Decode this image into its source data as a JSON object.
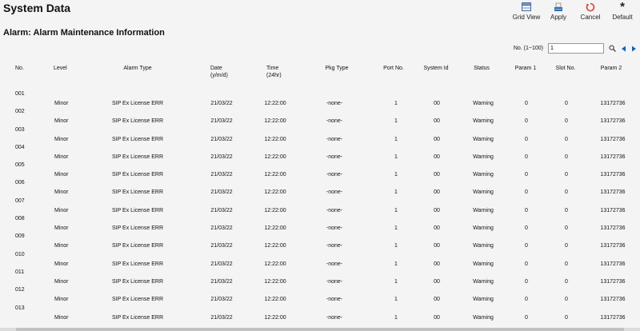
{
  "header": {
    "title": "System Data"
  },
  "toolbar": {
    "grid_view": "Grid View",
    "apply": "Apply",
    "cancel": "Cancel",
    "default": "Default"
  },
  "section": {
    "title": "Alarm: Alarm Maintenance Information"
  },
  "pager": {
    "label": "No. (1~100)",
    "value": "1"
  },
  "table": {
    "headers": {
      "no": "No.",
      "level": "Level",
      "alarm_type": "Alarm Type",
      "date": "Date",
      "date_sub": "(y/m/d)",
      "time": "Time",
      "time_sub": "(24hr)",
      "pkg_type": "Pkg Type",
      "port_no": "Port No.",
      "system_id": "System Id",
      "status": "Status",
      "param1": "Param 1",
      "slot_no": "Slot No.",
      "param2": "Param 2"
    },
    "rows": [
      {
        "no": "001",
        "level": "Minor",
        "alarm_type": "SIP Ex License ERR",
        "date": "21/03/22",
        "time": "12:22:00",
        "pkg_type": "-none-",
        "port_no": "1",
        "system_id": "00",
        "status": "Warning",
        "param1": "0",
        "slot_no": "0",
        "param2": "13172736"
      },
      {
        "no": "002",
        "level": "Minor",
        "alarm_type": "SIP Ex License ERR",
        "date": "21/03/22",
        "time": "12:22:00",
        "pkg_type": "-none-",
        "port_no": "1",
        "system_id": "00",
        "status": "Warning",
        "param1": "0",
        "slot_no": "0",
        "param2": "13172736"
      },
      {
        "no": "003",
        "level": "Minor",
        "alarm_type": "SIP Ex License ERR",
        "date": "21/03/22",
        "time": "12:22:00",
        "pkg_type": "-none-",
        "port_no": "1",
        "system_id": "00",
        "status": "Warning",
        "param1": "0",
        "slot_no": "0",
        "param2": "13172736"
      },
      {
        "no": "004",
        "level": "Minor",
        "alarm_type": "SIP Ex License ERR",
        "date": "21/03/22",
        "time": "12:22:00",
        "pkg_type": "-none-",
        "port_no": "1",
        "system_id": "00",
        "status": "Warning",
        "param1": "0",
        "slot_no": "0",
        "param2": "13172736"
      },
      {
        "no": "005",
        "level": "Minor",
        "alarm_type": "SIP Ex License ERR",
        "date": "21/03/22",
        "time": "12:22:00",
        "pkg_type": "-none-",
        "port_no": "1",
        "system_id": "00",
        "status": "Warning",
        "param1": "0",
        "slot_no": "0",
        "param2": "13172736"
      },
      {
        "no": "006",
        "level": "Minor",
        "alarm_type": "SIP Ex License ERR",
        "date": "21/03/22",
        "time": "12:22:00",
        "pkg_type": "-none-",
        "port_no": "1",
        "system_id": "00",
        "status": "Warning",
        "param1": "0",
        "slot_no": "0",
        "param2": "13172736"
      },
      {
        "no": "007",
        "level": "Minor",
        "alarm_type": "SIP Ex License ERR",
        "date": "21/03/22",
        "time": "12:22:00",
        "pkg_type": "-none-",
        "port_no": "1",
        "system_id": "00",
        "status": "Warning",
        "param1": "0",
        "slot_no": "0",
        "param2": "13172736"
      },
      {
        "no": "008",
        "level": "Minor",
        "alarm_type": "SIP Ex License ERR",
        "date": "21/03/22",
        "time": "12:22:00",
        "pkg_type": "-none-",
        "port_no": "1",
        "system_id": "00",
        "status": "Warning",
        "param1": "0",
        "slot_no": "0",
        "param2": "13172736"
      },
      {
        "no": "009",
        "level": "Minor",
        "alarm_type": "SIP Ex License ERR",
        "date": "21/03/22",
        "time": "12:22:00",
        "pkg_type": "-none-",
        "port_no": "1",
        "system_id": "00",
        "status": "Warning",
        "param1": "0",
        "slot_no": "0",
        "param2": "13172736"
      },
      {
        "no": "010",
        "level": "Minor",
        "alarm_type": "SIP Ex License ERR",
        "date": "21/03/22",
        "time": "12:22:00",
        "pkg_type": "-none-",
        "port_no": "1",
        "system_id": "00",
        "status": "Warning",
        "param1": "0",
        "slot_no": "0",
        "param2": "13172736"
      },
      {
        "no": "011",
        "level": "Minor",
        "alarm_type": "SIP Ex License ERR",
        "date": "21/03/22",
        "time": "12:22:00",
        "pkg_type": "-none-",
        "port_no": "1",
        "system_id": "00",
        "status": "Warning",
        "param1": "0",
        "slot_no": "0",
        "param2": "13172736"
      },
      {
        "no": "012",
        "level": "Minor",
        "alarm_type": "SIP Ex License ERR",
        "date": "21/03/22",
        "time": "12:22:00",
        "pkg_type": "-none-",
        "port_no": "1",
        "system_id": "00",
        "status": "Warning",
        "param1": "0",
        "slot_no": "0",
        "param2": "13172736"
      },
      {
        "no": "013",
        "level": "Minor",
        "alarm_type": "SIP Ex License ERR",
        "date": "21/03/22",
        "time": "12:22:00",
        "pkg_type": "-none-",
        "port_no": "1",
        "system_id": "00",
        "status": "Warning",
        "param1": "0",
        "slot_no": "0",
        "param2": "13172736"
      }
    ]
  },
  "colors": {
    "background": "#f4f4f4",
    "nav_arrow": "#1a5fb4",
    "cancel_icon": "#d64541"
  },
  "icons": {
    "grid_view": "grid-view-icon",
    "apply": "apply-icon",
    "cancel": "cancel-icon",
    "default": "asterisk-icon",
    "search": "search-icon",
    "prev": "prev-page-icon",
    "next": "next-page-icon"
  }
}
